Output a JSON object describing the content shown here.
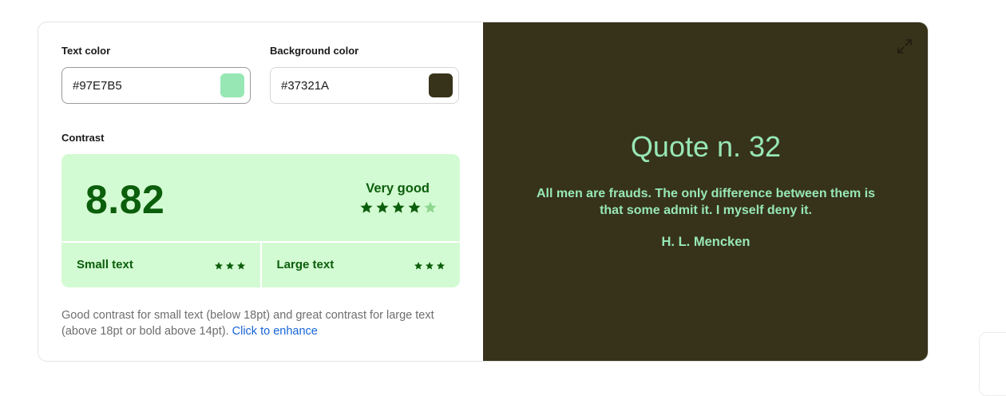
{
  "controls": {
    "text_color_label": "Text color",
    "text_color_value": "#97E7B5",
    "background_color_label": "Background color",
    "background_color_value": "#37321A"
  },
  "contrast": {
    "section_label": "Contrast",
    "ratio": "8.82",
    "rating_label": "Very good",
    "rating_stars": 4,
    "rating_max": 5,
    "small_text_label": "Small text",
    "small_text_stars": 3,
    "large_text_label": "Large text",
    "large_text_stars": 3,
    "description": "Good contrast for small text (below 18pt) and great contrast for large text (above 18pt or bold above 14pt).",
    "enhance_link": "Click to enhance"
  },
  "preview": {
    "title": "Quote n. 32",
    "quote": "All men are frauds. The only difference between them is that some admit it. I myself deny it.",
    "author": "H. L. Mencken",
    "expand_icon": "expand-icon"
  },
  "colors": {
    "contrast_bg": "#D3FBD3",
    "contrast_fg": "#0B5E0B",
    "star_empty": "#8FD68F",
    "link": "#1664D9"
  }
}
